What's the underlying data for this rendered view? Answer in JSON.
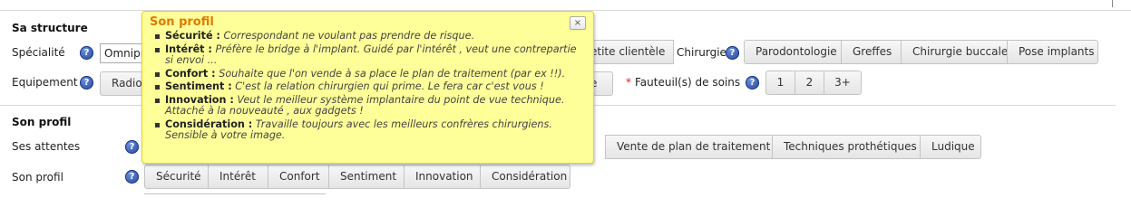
{
  "structure": {
    "title": "Sa structure",
    "specialite_label": "Spécialité",
    "specialite_value": "Omnipr",
    "equipement_label": "Equipement",
    "equipement_first_option": "Radio",
    "clientele_option": "etite clientèle",
    "equipement_option_partial": "e",
    "chirurgie_label": "Chirurgie",
    "chirurgie_options": [
      "Parodontologie",
      "Greffes",
      "Chirurgie buccale",
      "Pose implants"
    ],
    "fauteuils_required_mark": "*",
    "fauteuils_label": "Fauteuil(s) de soins",
    "fauteuils_options": [
      "1",
      "2",
      "3+"
    ]
  },
  "profil": {
    "title": "Son profil",
    "attentes_label": "Ses attentes",
    "attentes_options": [
      "Vente de plan de traitement",
      "Techniques prothétiques",
      "Ludique"
    ],
    "profil_label": "Son profil",
    "profil_options": [
      "Sécurité",
      "Intérêt",
      "Confort",
      "Sentiment",
      "Innovation",
      "Considération"
    ]
  },
  "help_icon_glyph": "?",
  "tooltip": {
    "title": "Son profil",
    "close_glyph": "×",
    "items": [
      {
        "term": "Sécurité :",
        "desc": "Correspondant ne voulant pas prendre de risque."
      },
      {
        "term": "Intérêt :",
        "desc": "Préfère le bridge à l'implant. Guidé par l'intérêt , veut une contrepartie si envoi ..."
      },
      {
        "term": "Confort :",
        "desc": "Souhaite que l'on vende à sa place le plan de traitement (par ex !!)."
      },
      {
        "term": "Sentiment :",
        "desc": "C'est la relation chirurgien qui prime. Le fera car c'est vous !"
      },
      {
        "term": "Innovation :",
        "desc": "Veut le meilleur système implantaire du point de vue technique. Attaché à la nouveauté , aux gadgets !"
      },
      {
        "term": "Considération :",
        "desc": "Travaille toujours avec les meilleurs confrères chirurgiens. Sensible à votre image."
      }
    ]
  },
  "colors": {
    "tooltip_bg": "#ffff99",
    "tooltip_title": "#e07a00",
    "help_icon": "#23439a",
    "required_mark": "#dd2222"
  }
}
